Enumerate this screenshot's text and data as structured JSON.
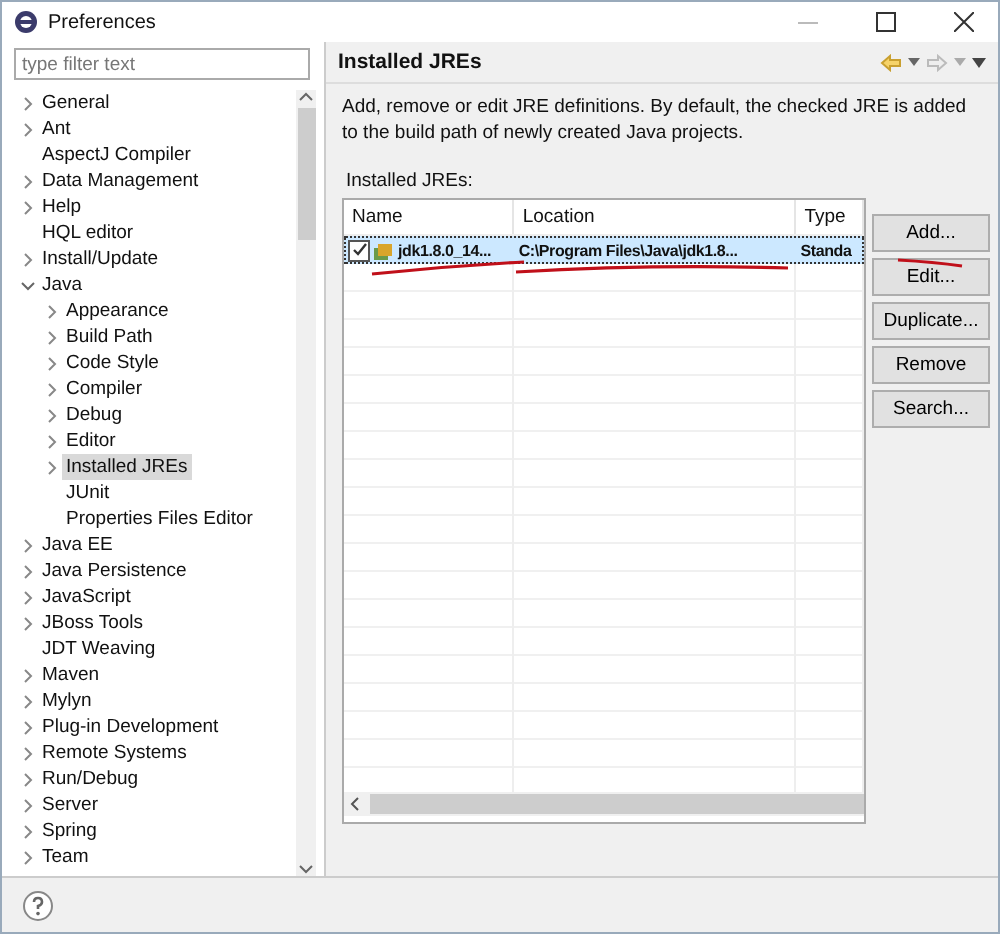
{
  "window": {
    "title": "Preferences"
  },
  "filter": {
    "placeholder": "type filter text"
  },
  "tree": [
    {
      "label": "General",
      "expanded": false,
      "selected": false
    },
    {
      "label": "Ant",
      "expanded": false,
      "selected": false
    },
    {
      "label": "AspectJ Compiler",
      "selected": false
    },
    {
      "label": "Data Management",
      "expanded": false,
      "selected": false
    },
    {
      "label": "Help",
      "expanded": false,
      "selected": false
    },
    {
      "label": "HQL editor",
      "selected": false
    },
    {
      "label": "Install/Update",
      "expanded": false,
      "selected": false
    },
    {
      "label": "Java",
      "expanded": true,
      "selected": false,
      "children": [
        {
          "label": "Appearance",
          "expanded": false,
          "selected": false
        },
        {
          "label": "Build Path",
          "expanded": false,
          "selected": false
        },
        {
          "label": "Code Style",
          "expanded": false,
          "selected": false
        },
        {
          "label": "Compiler",
          "expanded": false,
          "selected": false
        },
        {
          "label": "Debug",
          "expanded": false,
          "selected": false
        },
        {
          "label": "Editor",
          "expanded": false,
          "selected": false
        },
        {
          "label": "Installed JREs",
          "expanded": false,
          "selected": true
        },
        {
          "label": "JUnit",
          "selected": false
        },
        {
          "label": "Properties Files Editor",
          "selected": false
        }
      ]
    },
    {
      "label": "Java EE",
      "expanded": false,
      "selected": false
    },
    {
      "label": "Java Persistence",
      "expanded": false,
      "selected": false
    },
    {
      "label": "JavaScript",
      "expanded": false,
      "selected": false
    },
    {
      "label": "JBoss Tools",
      "expanded": false,
      "selected": false
    },
    {
      "label": "JDT Weaving",
      "selected": false
    },
    {
      "label": "Maven",
      "expanded": false,
      "selected": false
    },
    {
      "label": "Mylyn",
      "expanded": false,
      "selected": false
    },
    {
      "label": "Plug-in Development",
      "expanded": false,
      "selected": false
    },
    {
      "label": "Remote Systems",
      "expanded": false,
      "selected": false
    },
    {
      "label": "Run/Debug",
      "expanded": false,
      "selected": false
    },
    {
      "label": "Server",
      "expanded": false,
      "selected": false
    },
    {
      "label": "Spring",
      "expanded": false,
      "selected": false
    },
    {
      "label": "Team",
      "expanded": false,
      "selected": false
    }
  ],
  "page": {
    "title": "Installed JREs",
    "description": "Add, remove or edit JRE definitions. By default, the checked JRE is added to the build path of newly created Java projects.",
    "table_label": "Installed JREs:"
  },
  "table": {
    "columns": [
      "Name",
      "Location",
      "Type"
    ],
    "rows": [
      {
        "name": "jdk1.8.0_14...",
        "location": "C:\\Program Files\\Java\\jdk1.8...",
        "type": "Standa",
        "checked": true,
        "selected": true
      }
    ]
  },
  "buttons": [
    {
      "label": "Add..."
    },
    {
      "label": "Edit..."
    },
    {
      "label": "Duplicate..."
    },
    {
      "label": "Remove"
    },
    {
      "label": "Search..."
    }
  ]
}
